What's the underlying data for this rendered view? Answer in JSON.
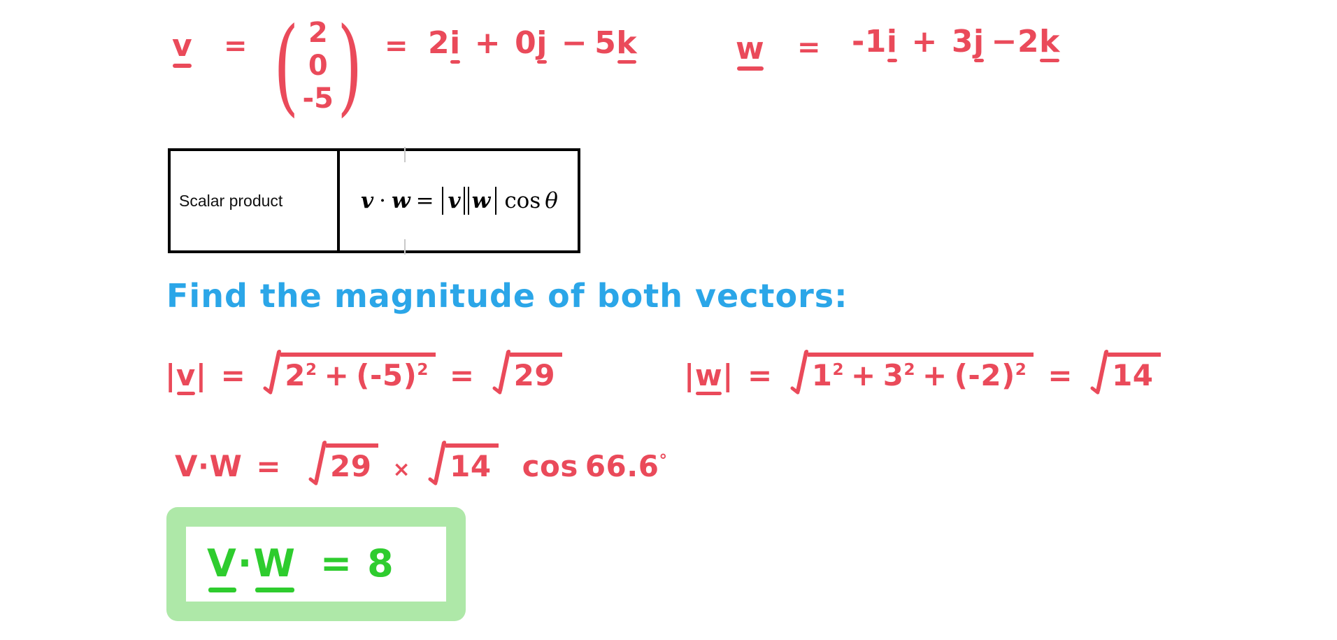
{
  "document": {
    "subject": "Vector scalar (dot) product worked example",
    "background_color": "#ffffff"
  },
  "colors": {
    "handwriting_red": "#ea4a5a",
    "handwriting_blue": "#2ba6e8",
    "handwriting_green": "#2ecc2e",
    "highlight_green": "#aee8a8",
    "table_border": "#000000",
    "ghost_tick": "#c9c9c9"
  },
  "line_v_definition": {
    "vector_name": "v",
    "equals_1": "=",
    "column_vector": [
      "2",
      "0",
      "-5"
    ],
    "equals_2": "=",
    "component_form": {
      "i_coefficient": "2",
      "i_unit": "i",
      "plus": "+",
      "j_coefficient": "0",
      "j_unit": "j",
      "minus": "−",
      "k_coefficient": "5",
      "k_unit": "k"
    }
  },
  "line_w_definition": {
    "vector_name": "w",
    "equals": "=",
    "component_form": {
      "i_coefficient": "-1",
      "i_unit": "i",
      "plus": "+",
      "j_coefficient": "3",
      "j_unit": "j",
      "minus": "−",
      "k_coefficient": "2",
      "k_unit": "k"
    }
  },
  "definition_table": {
    "row_label": "Scalar product",
    "formula": {
      "left_v": "v",
      "dot": "·",
      "left_w": "w",
      "equals": "=",
      "mag_v": "v",
      "mag_w": "w",
      "cos": "cos",
      "theta": "θ"
    }
  },
  "instruction": {
    "text": "Find  the  magnitude  of  both  vectors:"
  },
  "magnitude_v": {
    "label": "v",
    "equals_1": "=",
    "radicand": {
      "term_1_base": "2",
      "term_1_exp": "2",
      "plus": "+",
      "term_2_base": "(-5)",
      "term_2_exp": "2"
    },
    "equals_2": "=",
    "result_radicand": "29"
  },
  "magnitude_w": {
    "label": "w",
    "equals_1": "=",
    "radicand": {
      "term_1_base": "1",
      "term_1_exp": "2",
      "plus_1": "+",
      "term_2_base": "3",
      "term_2_exp": "2",
      "plus_2": "+",
      "term_3_base": "(-2)",
      "term_3_exp": "2"
    },
    "equals_2": "=",
    "result_radicand": "14"
  },
  "dot_product_line": {
    "left_v": "V",
    "dot": "·",
    "left_w": "W",
    "equals": "=",
    "sqrt_1": "29",
    "times": "×",
    "sqrt_2": "14",
    "cos": "cos",
    "angle": "66.6",
    "degree": "°"
  },
  "answer": {
    "left_v": "V",
    "dot": "·",
    "left_w": "W",
    "equals": "=",
    "value": "8"
  }
}
